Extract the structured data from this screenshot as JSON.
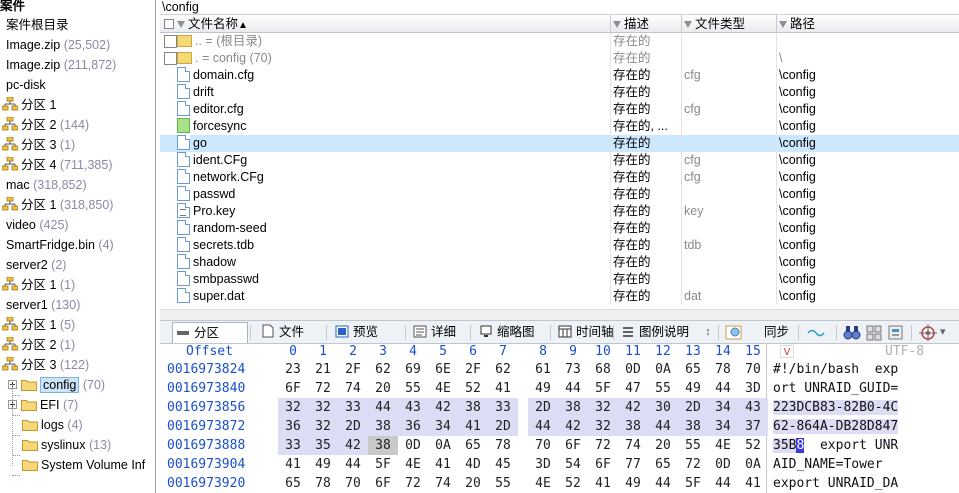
{
  "tree": {
    "title": "案件",
    "root": "案件根目录",
    "items": [
      {
        "label": "Image.zip",
        "count": "(25,502)",
        "type": "file",
        "indent": 0
      },
      {
        "label": "Image.zip",
        "count": "(211,872)",
        "type": "file",
        "indent": 0
      },
      {
        "label": "pc-disk",
        "count": "",
        "type": "file",
        "indent": 0
      },
      {
        "label": "分区 1",
        "count": "",
        "type": "partition",
        "indent": 0
      },
      {
        "label": "分区 2",
        "count": "(144)",
        "type": "partition",
        "indent": 0
      },
      {
        "label": "分区 3",
        "count": "(1)",
        "type": "partition",
        "indent": 0
      },
      {
        "label": "分区 4",
        "count": "(711,385)",
        "type": "partition",
        "indent": 0
      },
      {
        "label": "mac",
        "count": "(318,852)",
        "type": "file",
        "indent": 0
      },
      {
        "label": "分区 1",
        "count": "(318,850)",
        "type": "partition",
        "indent": 0
      },
      {
        "label": "video",
        "count": "(425)",
        "type": "file",
        "indent": 0
      },
      {
        "label": "SmartFridge.bin",
        "count": "(4)",
        "type": "file",
        "indent": 0
      },
      {
        "label": "server2",
        "count": "(2)",
        "type": "file",
        "indent": 0
      },
      {
        "label": "分区 1",
        "count": "(1)",
        "type": "partition",
        "indent": 0
      },
      {
        "label": "server1",
        "count": "(130)",
        "type": "file",
        "indent": 0
      },
      {
        "label": "分区 1",
        "count": "(5)",
        "type": "partition",
        "indent": 0
      },
      {
        "label": "分区 2",
        "count": "(1)",
        "type": "partition",
        "indent": 0
      },
      {
        "label": "分区 3",
        "count": "(122)",
        "type": "partition",
        "indent": 0
      },
      {
        "label": "config",
        "count": "(70)",
        "type": "folder",
        "indent": 1,
        "selected": true,
        "expander": true
      },
      {
        "label": "EFI",
        "count": "(7)",
        "type": "folder",
        "indent": 1,
        "expander": true
      },
      {
        "label": "logs",
        "count": "(4)",
        "type": "folder",
        "indent": 1
      },
      {
        "label": "syslinux",
        "count": "(13)",
        "type": "folder",
        "indent": 1
      },
      {
        "label": "System Volume Inf",
        "count": "",
        "type": "folder",
        "indent": 1
      }
    ]
  },
  "filelist": {
    "path": "\\config",
    "columns": [
      "文件名称",
      "描述",
      "文件类型",
      "路径"
    ],
    "sort_indicator": "▲",
    "rows": [
      {
        "name": "..  =  (根目录)",
        "desc": "存在的",
        "type": "",
        "path": "",
        "kind": "up",
        "gray": true
      },
      {
        "name": ".  =  config (70)",
        "desc": "存在的",
        "type": "",
        "path": "\\",
        "kind": "dir",
        "gray": true
      },
      {
        "name": "domain.cfg",
        "desc": "存在的",
        "type": "cfg",
        "path": "\\config",
        "kind": "file"
      },
      {
        "name": "drift",
        "desc": "存在的",
        "type": "",
        "path": "\\config",
        "kind": "file"
      },
      {
        "name": "editor.cfg",
        "desc": "存在的",
        "type": "cfg",
        "path": "\\config",
        "kind": "file"
      },
      {
        "name": "forcesync",
        "desc": "存在的, ...",
        "type": "",
        "path": "\\config",
        "kind": "green"
      },
      {
        "name": "go",
        "desc": "存在的",
        "type": "",
        "path": "\\config",
        "kind": "file",
        "selected": true
      },
      {
        "name": "ident.CFg",
        "desc": "存在的",
        "type": "cfg",
        "path": "\\config",
        "kind": "file"
      },
      {
        "name": "network.CFg",
        "desc": "存在的",
        "type": "cfg",
        "path": "\\config",
        "kind": "file"
      },
      {
        "name": "passwd",
        "desc": "存在的",
        "type": "",
        "path": "\\config",
        "kind": "file"
      },
      {
        "name": "Pro.key",
        "desc": "存在的",
        "type": "key",
        "path": "\\config",
        "kind": "doc"
      },
      {
        "name": "random-seed",
        "desc": "存在的",
        "type": "",
        "path": "\\config",
        "kind": "file"
      },
      {
        "name": "secrets.tdb",
        "desc": "存在的",
        "type": "tdb",
        "path": "\\config",
        "kind": "file"
      },
      {
        "name": "shadow",
        "desc": "存在的",
        "type": "",
        "path": "\\config",
        "kind": "file"
      },
      {
        "name": "smbpasswd",
        "desc": "存在的",
        "type": "",
        "path": "\\config",
        "kind": "file"
      },
      {
        "name": "super.dat",
        "desc": "存在的",
        "type": "dat",
        "path": "\\config",
        "kind": "file"
      }
    ]
  },
  "tabs": {
    "items": [
      "分区",
      "文件",
      "预览",
      "详细",
      "缩略图",
      "时间轴",
      "图例说明"
    ],
    "active": 0,
    "sync_label": "同步"
  },
  "hex": {
    "offset_header": "Offset",
    "encoding": "UTF-8",
    "columns": [
      "0",
      "1",
      "2",
      "3",
      "4",
      "5",
      "6",
      "7",
      "8",
      "9",
      "10",
      "11",
      "12",
      "13",
      "14",
      "15"
    ],
    "rows": [
      {
        "offset": "0016973824",
        "bytes": [
          "23",
          "21",
          "2F",
          "62",
          "69",
          "6E",
          "2F",
          "62",
          "61",
          "73",
          "68",
          "0D",
          "0A",
          "65",
          "78",
          "70"
        ],
        "text": "#!/bin/bash  exp",
        "hl": []
      },
      {
        "offset": "0016973840",
        "bytes": [
          "6F",
          "72",
          "74",
          "20",
          "55",
          "4E",
          "52",
          "41",
          "49",
          "44",
          "5F",
          "47",
          "55",
          "49",
          "44",
          "3D"
        ],
        "text": "ort UNRAID_GUID=",
        "hl": []
      },
      {
        "offset": "0016973856",
        "bytes": [
          "32",
          "32",
          "33",
          "44",
          "43",
          "42",
          "38",
          "33",
          "2D",
          "38",
          "32",
          "42",
          "30",
          "2D",
          "34",
          "43"
        ],
        "text": "223DCB83-82B0-4C",
        "hl": [
          0,
          1,
          2,
          3,
          4,
          5,
          6,
          7,
          8,
          9,
          10,
          11,
          12,
          13,
          14,
          15
        ]
      },
      {
        "offset": "0016973872",
        "bytes": [
          "36",
          "32",
          "2D",
          "38",
          "36",
          "34",
          "41",
          "2D",
          "44",
          "42",
          "32",
          "38",
          "44",
          "38",
          "34",
          "37"
        ],
        "text": "62-864A-DB28D847",
        "hl": [
          0,
          1,
          2,
          3,
          4,
          5,
          6,
          7,
          8,
          9,
          10,
          11,
          12,
          13,
          14,
          15
        ]
      },
      {
        "offset": "0016973888",
        "bytes": [
          "33",
          "35",
          "42",
          "38",
          "0D",
          "0A",
          "65",
          "78",
          "70",
          "6F",
          "72",
          "74",
          "20",
          "55",
          "4E",
          "52"
        ],
        "text_hl": "35B",
        "text_cur": "8",
        "text_rest": "  export UNR",
        "hl": [
          0,
          1,
          2
        ],
        "cur": 3
      },
      {
        "offset": "0016973904",
        "bytes": [
          "41",
          "49",
          "44",
          "5F",
          "4E",
          "41",
          "4D",
          "45",
          "3D",
          "54",
          "6F",
          "77",
          "65",
          "72",
          "0D",
          "0A"
        ],
        "text": "AID_NAME=Tower",
        "hl": []
      },
      {
        "offset": "0016973920",
        "bytes": [
          "65",
          "78",
          "70",
          "6F",
          "72",
          "74",
          "20",
          "55",
          "4E",
          "52",
          "41",
          "49",
          "44",
          "5F",
          "44",
          "41"
        ],
        "text": "export UNRAID_DA",
        "hl": []
      }
    ]
  }
}
